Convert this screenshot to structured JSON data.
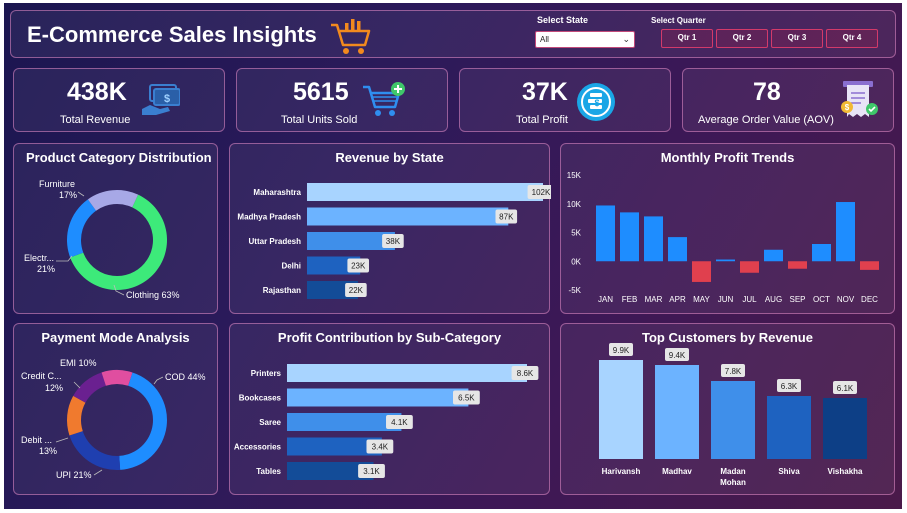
{
  "header": {
    "title": "E-Commerce Sales Insights",
    "state_label": "Select State",
    "state_value": "All",
    "quarter_label": "Select Quarter",
    "quarters": [
      "Qtr 1",
      "Qtr 2",
      "Qtr 3",
      "Qtr 4"
    ]
  },
  "kpis": [
    {
      "value": "438K",
      "label": "Total Revenue",
      "icon": "money-icon"
    },
    {
      "value": "5615",
      "label": "Total Units Sold",
      "icon": "cart-add-icon"
    },
    {
      "value": "37K",
      "label": "Total Profit",
      "icon": "coins-icon"
    },
    {
      "value": "78",
      "label": "Average Order Value (AOV)",
      "icon": "receipt-icon"
    }
  ],
  "colors": {
    "accent_orange": "#f28a1e",
    "bar_light": "#a8d4ff",
    "bar_mid": "#4f9af0",
    "bar_dark": "#1b5eb8",
    "bar_darkest": "#0d3f86",
    "negative": "#e0404e",
    "donut_green": "#3dea7a",
    "donut_blue": "#1e8dff",
    "donut_lavender": "#a7a8e6"
  },
  "panels": {
    "category": "Product Category Distribution",
    "state": "Revenue by State",
    "monthly": "Monthly Profit Trends",
    "payment": "Payment Mode Analysis",
    "subcategory": "Profit Contribution by Sub-Category",
    "customers": "Top Customers by Revenue"
  },
  "chart_data": [
    {
      "type": "pie",
      "title": "Product Category Distribution",
      "categories": [
        "Clothing",
        "Electr...",
        "Furniture"
      ],
      "values": [
        63,
        21,
        17
      ],
      "labels": [
        "Clothing 63%",
        "Electr...",
        "21%",
        "Furniture",
        "17%"
      ]
    },
    {
      "type": "bar",
      "title": "Revenue by State",
      "categories": [
        "Maharashtra",
        "Madhya Pradesh",
        "Uttar Pradesh",
        "Delhi",
        "Rajasthan"
      ],
      "values": [
        102,
        87,
        38,
        23,
        22
      ],
      "data_labels": [
        "102K",
        "87K",
        "38K",
        "23K",
        "22K"
      ]
    },
    {
      "type": "bar",
      "title": "Monthly Profit Trends",
      "categories": [
        "JAN",
        "FEB",
        "MAR",
        "APR",
        "MAY",
        "JUN",
        "JUL",
        "AUG",
        "SEP",
        "OCT",
        "NOV",
        "DEC"
      ],
      "values": [
        9.7,
        8.5,
        7.8,
        4.2,
        -3.6,
        0.3,
        -2.0,
        2.0,
        -1.3,
        3.0,
        10.3,
        -1.5
      ],
      "ylim": [
        -5,
        15
      ],
      "yticks": [
        15,
        10,
        5,
        0,
        -5
      ],
      "ytick_labels": [
        "15K",
        "10K",
        "5K",
        "0K",
        "-5K"
      ]
    },
    {
      "type": "pie",
      "title": "Payment Mode Analysis",
      "categories": [
        "COD",
        "UPI",
        "Debit ...",
        "Credit C...",
        "EMI"
      ],
      "values": [
        44,
        21,
        13,
        12,
        10
      ],
      "labels": [
        "COD 44%",
        "UPI 21%",
        "Debit ...",
        "13%",
        "Credit C...",
        "12%",
        "EMI 10%"
      ]
    },
    {
      "type": "bar",
      "title": "Profit Contribution by Sub-Category",
      "categories": [
        "Printers",
        "Bookcases",
        "Saree",
        "Accessories",
        "Tables"
      ],
      "values": [
        8.6,
        6.5,
        4.1,
        3.4,
        3.1
      ],
      "data_labels": [
        "8.6K",
        "6.5K",
        "4.1K",
        "3.4K",
        "3.1K"
      ]
    },
    {
      "type": "bar",
      "title": "Top Customers by Revenue",
      "categories": [
        "Harivansh",
        "Madhav",
        "Madan Mohan",
        "Shiva",
        "Vishakha"
      ],
      "category_lines": [
        [
          "Harivansh"
        ],
        [
          "Madhav"
        ],
        [
          "Madan",
          "Mohan"
        ],
        [
          "Shiva"
        ],
        [
          "Vishakha"
        ]
      ],
      "values": [
        9.9,
        9.4,
        7.8,
        6.3,
        6.1
      ],
      "data_labels": [
        "9.9K",
        "9.4K",
        "7.8K",
        "6.3K",
        "6.1K"
      ]
    }
  ]
}
